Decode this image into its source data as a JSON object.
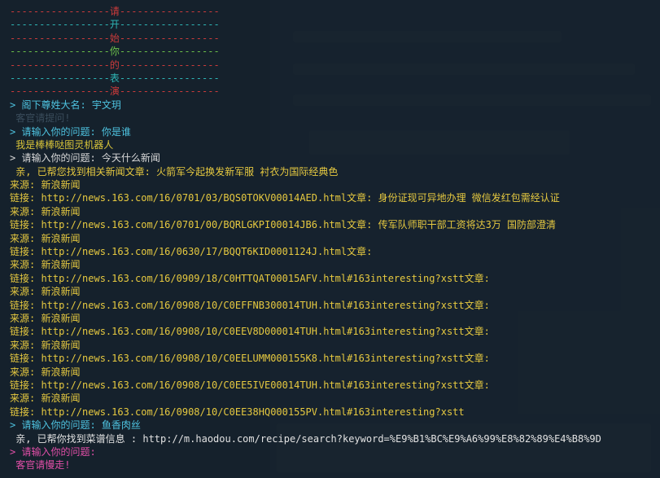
{
  "banner": [
    {
      "left": "-----------------",
      "char": "请",
      "right": "-----------------",
      "color": "#cc3b3b"
    },
    {
      "left": "-----------------",
      "char": "开",
      "right": "-----------------",
      "color": "#2eb6b6"
    },
    {
      "left": "-----------------",
      "char": "始",
      "right": "-----------------",
      "color": "#cc3b3b"
    },
    {
      "left": "-----------------",
      "char": "你",
      "right": "-----------------",
      "color": "#6cc04a"
    },
    {
      "left": "-----------------",
      "char": "的",
      "right": "-----------------",
      "color": "#cc3b3b"
    },
    {
      "left": "-----------------",
      "char": "表",
      "right": "-----------------",
      "color": "#2eb6b6"
    },
    {
      "left": "-----------------",
      "char": "演",
      "right": "-----------------",
      "color": "#cc3b3b"
    }
  ],
  "session": {
    "name_prompt": "> 阁下尊姓大名: 宇文玥",
    "greet_faint": " 客官请提问!",
    "q1": "> 请输入你的问题: 你是谁",
    "a1": " 我是棒棒哒图灵机器人",
    "q2": "> 请输入你的问题: 今天什么新闻",
    "a2_intro": " 亲, 已帮您找到相关新闻文章: 火箭军今起换发新军服 衬衣为国际经典色",
    "news_lines": [
      "来源: 新浪新闻",
      "链接: http://news.163.com/16/0701/03/BQS0TOKV00014AED.html文章: 身份证现可异地办理 微信发红包需经认证",
      "来源: 新浪新闻",
      "链接: http://news.163.com/16/0701/00/BQRLGKPI00014JB6.html文章: 传军队师职干部工资将达3万 国防部澄清",
      "来源: 新浪新闻",
      "链接: http://news.163.com/16/0630/17/BQQT6KID0001124J.html文章:",
      "来源: 新浪新闻",
      "链接: http://news.163.com/16/0909/18/C0HTTQAT00015AFV.html#163interesting?xstt文章:",
      "来源: 新浪新闻",
      "链接: http://news.163.com/16/0908/10/C0EFFNB300014TUH.html#163interesting?xstt文章:",
      "来源: 新浪新闻",
      "链接: http://news.163.com/16/0908/10/C0EEV8D000014TUH.html#163interesting?xstt文章:",
      "来源: 新浪新闻",
      "链接: http://news.163.com/16/0908/10/C0EELUMM000155K8.html#163interesting?xstt文章:",
      "来源: 新浪新闻",
      "链接: http://news.163.com/16/0908/10/C0EE5IVE00014TUH.html#163interesting?xstt文章:",
      "来源: 新浪新闻",
      "链接: http://news.163.com/16/0908/10/C0EE38HQ000155PV.html#163interesting?xstt"
    ],
    "q3": "> 请输入你的问题: 鱼香肉丝",
    "a3": " 亲, 已帮你找到菜谱信息 : http://m.haodou.com/recipe/search?keyword=%E9%B1%BC%E9%A6%99%E8%82%89%E4%B8%9D",
    "q4": "> 请输入你的问题:",
    "bye": " 客官请慢走!"
  }
}
